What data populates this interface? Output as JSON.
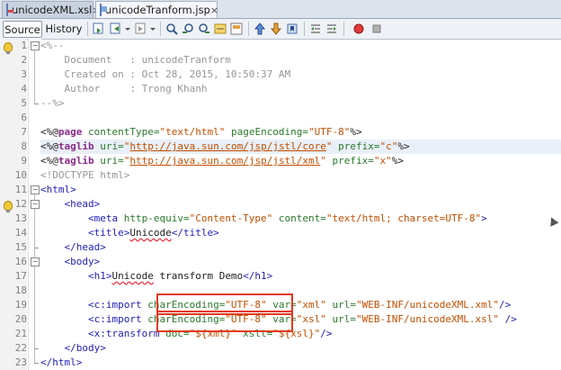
{
  "tabs": [
    {
      "label": "unicodeXML.xsl",
      "close": "×",
      "icon": "xsl-file-icon",
      "active": false
    },
    {
      "label": "unicodeTranform.jsp",
      "close": "×",
      "icon": "jsp-file-icon",
      "active": true
    }
  ],
  "toolbar": {
    "source_label": "Source",
    "history_label": "History"
  },
  "editor": {
    "lines": [
      {
        "n": "1"
      },
      {
        "n": "2"
      },
      {
        "n": "3"
      },
      {
        "n": "4"
      },
      {
        "n": "5"
      },
      {
        "n": "6"
      },
      {
        "n": "7"
      },
      {
        "n": "8"
      },
      {
        "n": "9"
      },
      {
        "n": "10"
      },
      {
        "n": "11"
      },
      {
        "n": "12"
      },
      {
        "n": "13"
      },
      {
        "n": "14"
      },
      {
        "n": "15"
      },
      {
        "n": "16"
      },
      {
        "n": "17"
      },
      {
        "n": "18"
      },
      {
        "n": "19"
      },
      {
        "n": "20"
      },
      {
        "n": "21"
      },
      {
        "n": "22"
      },
      {
        "n": "23"
      }
    ],
    "code": {
      "l1": "<%--",
      "l2a": "    Document   : ",
      "l2b": "unicodeTranform",
      "l3a": "    Created on : ",
      "l3b": "Oct 28, 2015, 10:50:37 AM",
      "l4a": "    Author     : ",
      "l4b": "Trong Khanh",
      "l5": "--%>",
      "l7_open": "<%@",
      "l7_dir": "page",
      "l7_a1": " contentType=",
      "l7_v1": "\"text/html\"",
      "l7_a2": " pageEncoding=",
      "l7_v2": "\"UTF-8\"",
      "l7_close": "%>",
      "l8_open": "<%@",
      "l8_dir": "taglib",
      "l8_a1": " uri=",
      "l8_q1": "\"",
      "l8_link": "http://java.sun.com/jsp/jstl/core",
      "l8_q2": "\"",
      "l8_a2": " prefix=",
      "l8_v2": "\"c\"",
      "l8_close": "%>",
      "l9_open": "<%@",
      "l9_dir": "taglib",
      "l9_a1": " uri=",
      "l9_q1": "\"",
      "l9_link": "http://java.sun.com/jsp/jstl/xml",
      "l9_q2": "\"",
      "l9_a2": " prefix=",
      "l9_v2": "\"x\"",
      "l9_close": "%>",
      "l10": "<!DOCTYPE html>",
      "l11": "<html>",
      "l12": "    <head>",
      "l13_open": "        <meta",
      "l13_a1": " http-equiv=",
      "l13_v1": "\"Content-Type\"",
      "l13_a2": " content=",
      "l13_v2": "\"text/html; charset=UTF-8\"",
      "l13_close": ">",
      "l14_open": "        <title>",
      "l14_text": "Unicode",
      "l14_close": "</title>",
      "l15": "    </head>",
      "l16": "    <body>",
      "l17_open": "        <h1>",
      "l17_text1": "Unicode",
      "l17_text2": " transform Demo",
      "l17_close": "</h1>",
      "l19_open": "        <c:import",
      "l19_a1": " charEncoding=",
      "l19_v1": "\"UTF-8\"",
      "l19_a2": " var=",
      "l19_v2": "\"xml\"",
      "l19_a3": " url=",
      "l19_v3": "\"WEB-INF/unicodeXML.xml\"",
      "l19_close": "/>",
      "l20_open": "        <c:import",
      "l20_a1": " charEncoding=",
      "l20_v1": "\"UTF-8\"",
      "l20_a2": " var=",
      "l20_v2": "\"xsl\"",
      "l20_a3": " url=",
      "l20_v3": "\"WEB-INF/unicodeXML.xsl\"",
      "l20_close": " />",
      "l21_open": "        <x:transform",
      "l21_a1": " doc=",
      "l21_v1": "\"${xml}\"",
      "l21_a2": " xslt=",
      "l21_v2": "\"${xsl}\"",
      "l21_close": "/>",
      "l22": "    </body>",
      "l23": "</html>"
    }
  },
  "colors": {
    "highlight_box": "#e33a1c",
    "tag": "#1d1dbb",
    "attribute": "#2a7a2a",
    "value": "#c24e00",
    "comment": "#969696"
  }
}
